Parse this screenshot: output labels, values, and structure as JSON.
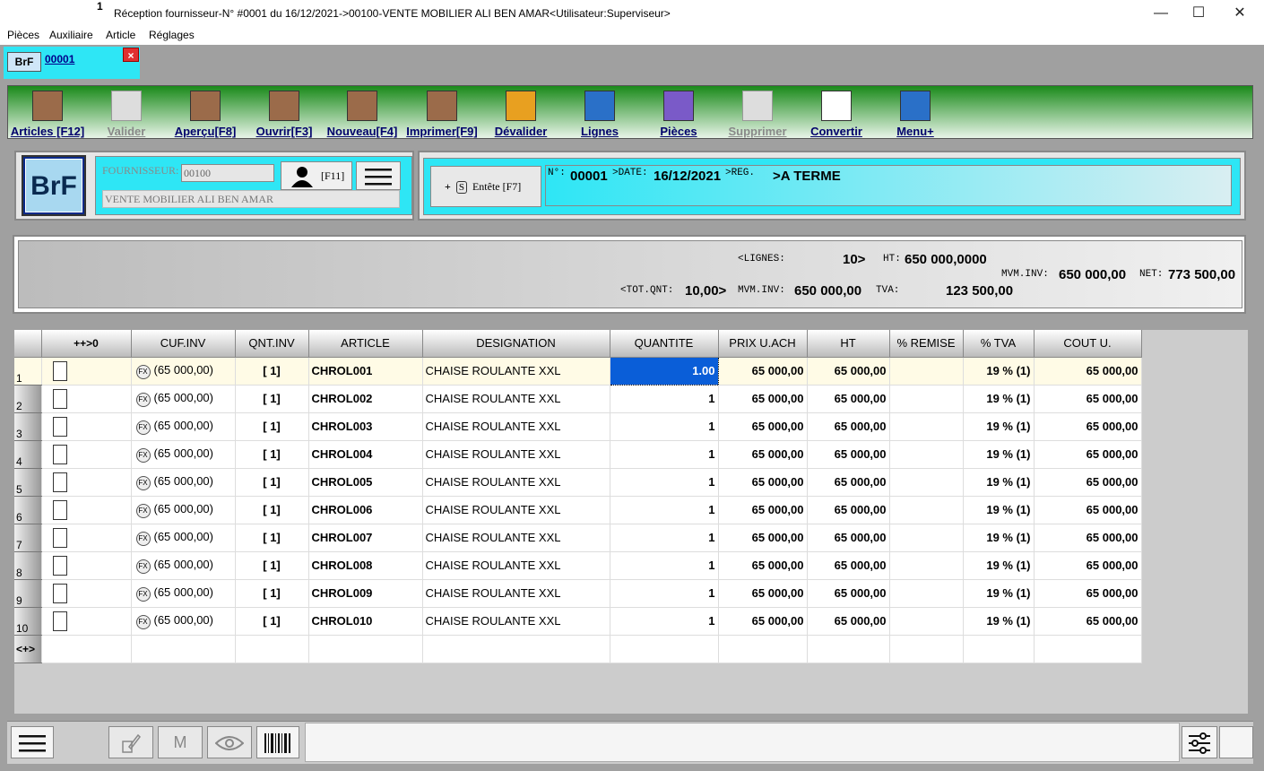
{
  "window": {
    "number": "1",
    "title": "Réception fournisseur-N° #0001 du 16/12/2021->00100-VENTE MOBILIER ALI BEN AMAR<Utilisateur:Superviseur>",
    "minimize": "—",
    "maximize": "☐",
    "close": "✕"
  },
  "menubar": [
    "Pièces",
    "Auxiliaire",
    "Article",
    "Réglages"
  ],
  "tab": {
    "code": "BrF",
    "number": "00001",
    "close": "×"
  },
  "toolbar": [
    {
      "label": "Articles [F12]",
      "icon": "articles-icon",
      "enabled": true,
      "color": "#9b6b4a"
    },
    {
      "label": "Valider",
      "icon": "validate-icon",
      "enabled": false,
      "color": "#dddddd"
    },
    {
      "label": "Aperçu[F8]",
      "icon": "preview-icon",
      "enabled": true,
      "color": "#9b6b4a"
    },
    {
      "label": "Ouvrir[F3]",
      "icon": "open-icon",
      "enabled": true,
      "color": "#9b6b4a"
    },
    {
      "label": "Nouveau[F4]",
      "icon": "new-icon",
      "enabled": true,
      "color": "#9b6b4a"
    },
    {
      "label": "Imprimer[F9]",
      "icon": "print-icon",
      "enabled": true,
      "color": "#9b6b4a"
    },
    {
      "label": "Dévalider",
      "icon": "unvalidate-icon",
      "enabled": true,
      "color": "#e8a020"
    },
    {
      "label": "Lignes",
      "icon": "lines-search-icon",
      "enabled": true,
      "color": "#2a70c8"
    },
    {
      "label": "Pièces",
      "icon": "pieces-grid-icon",
      "enabled": true,
      "color": "#7a5ac8"
    },
    {
      "label": "Supprimer",
      "icon": "delete-icon",
      "enabled": false,
      "color": "#dddddd"
    },
    {
      "label": "Convertir",
      "icon": "convert-icon",
      "enabled": true,
      "color": "#ffffff"
    },
    {
      "label": "Menu+",
      "icon": "menu-plus-icon",
      "enabled": true,
      "color": "#2a70c8"
    }
  ],
  "header": {
    "doc_type": "BrF",
    "fournisseur_label": "FOURNISSEUR:",
    "fournisseur_code": "00100",
    "fournisseur_name": "VENTE MOBILIER ALI BEN AMAR",
    "person_shortcut": "[F11]",
    "entete_label": "Entête [F7]",
    "entete_plus": "+",
    "entete_s": "S",
    "num_label": "N°:",
    "num_value": "00001",
    "date_label": ">DATE:",
    "date_value": "16/12/2021",
    "reg_label": ">REG.",
    "reg_value": ">A TERME"
  },
  "totals": {
    "lignes_label": "<LIGNES:",
    "lignes_value": "10>",
    "ht_label": "HT:",
    "ht_value": "650 000,0000",
    "totqnt_label": "<TOT.QNT:",
    "totqnt_value": "10,00>",
    "mvm_inv_label": "MVM.INV:",
    "mvm_inv_value": "650 000,00",
    "tva_label": "TVA:",
    "tva_value": "123 500,00",
    "mvm_inv2_label": "MVM.INV:",
    "mvm_inv2_value": "650 000,00",
    "net_label": "NET:",
    "net_value": "773 500,00"
  },
  "grid": {
    "columns": [
      "++>0",
      "CUF.INV",
      "QNT.INV",
      "ARTICLE",
      "DESIGNATION",
      "QUANTITE",
      "PRIX U.ACH",
      "HT",
      "% REMISE",
      "% TVA",
      "COUT U."
    ],
    "rows": [
      {
        "n": "1",
        "cuf": "(65 000,00)",
        "qnt_inv": "[ 1]",
        "article": "CHROL001",
        "designation": "CHAISE ROULANTE XXL",
        "quantite": "1.00",
        "prix": "65 000,00",
        "ht": "65 000,00",
        "remise": "",
        "tva": "19 % (1)",
        "cout": "65 000,00"
      },
      {
        "n": "2",
        "cuf": "(65 000,00)",
        "qnt_inv": "[ 1]",
        "article": "CHROL002",
        "designation": "CHAISE ROULANTE XXL",
        "quantite": "1",
        "prix": "65 000,00",
        "ht": "65 000,00",
        "remise": "",
        "tva": "19 % (1)",
        "cout": "65 000,00"
      },
      {
        "n": "3",
        "cuf": "(65 000,00)",
        "qnt_inv": "[ 1]",
        "article": "CHROL003",
        "designation": "CHAISE ROULANTE XXL",
        "quantite": "1",
        "prix": "65 000,00",
        "ht": "65 000,00",
        "remise": "",
        "tva": "19 % (1)",
        "cout": "65 000,00"
      },
      {
        "n": "4",
        "cuf": "(65 000,00)",
        "qnt_inv": "[ 1]",
        "article": "CHROL004",
        "designation": "CHAISE ROULANTE XXL",
        "quantite": "1",
        "prix": "65 000,00",
        "ht": "65 000,00",
        "remise": "",
        "tva": "19 % (1)",
        "cout": "65 000,00"
      },
      {
        "n": "5",
        "cuf": "(65 000,00)",
        "qnt_inv": "[ 1]",
        "article": "CHROL005",
        "designation": "CHAISE ROULANTE XXL",
        "quantite": "1",
        "prix": "65 000,00",
        "ht": "65 000,00",
        "remise": "",
        "tva": "19 % (1)",
        "cout": "65 000,00"
      },
      {
        "n": "6",
        "cuf": "(65 000,00)",
        "qnt_inv": "[ 1]",
        "article": "CHROL006",
        "designation": "CHAISE ROULANTE XXL",
        "quantite": "1",
        "prix": "65 000,00",
        "ht": "65 000,00",
        "remise": "",
        "tva": "19 % (1)",
        "cout": "65 000,00"
      },
      {
        "n": "7",
        "cuf": "(65 000,00)",
        "qnt_inv": "[ 1]",
        "article": "CHROL007",
        "designation": "CHAISE ROULANTE XXL",
        "quantite": "1",
        "prix": "65 000,00",
        "ht": "65 000,00",
        "remise": "",
        "tva": "19 % (1)",
        "cout": "65 000,00"
      },
      {
        "n": "8",
        "cuf": "(65 000,00)",
        "qnt_inv": "[ 1]",
        "article": "CHROL008",
        "designation": "CHAISE ROULANTE XXL",
        "quantite": "1",
        "prix": "65 000,00",
        "ht": "65 000,00",
        "remise": "",
        "tva": "19 % (1)",
        "cout": "65 000,00"
      },
      {
        "n": "9",
        "cuf": "(65 000,00)",
        "qnt_inv": "[ 1]",
        "article": "CHROL009",
        "designation": "CHAISE ROULANTE XXL",
        "quantite": "1",
        "prix": "65 000,00",
        "ht": "65 000,00",
        "remise": "",
        "tva": "19 % (1)",
        "cout": "65 000,00"
      },
      {
        "n": "10",
        "cuf": "(65 000,00)",
        "qnt_inv": "[ 1]",
        "article": "CHROL010",
        "designation": "CHAISE ROULANTE XXL",
        "quantite": "1",
        "prix": "65 000,00",
        "ht": "65 000,00",
        "remise": "",
        "tva": "19 % (1)",
        "cout": "65 000,00"
      }
    ],
    "new_row_marker": "<+>",
    "fx_label": "FX"
  },
  "bottombar": {
    "menu_icon": "hamburger-icon",
    "edit_icon": "edit-icon",
    "m_label": "M",
    "eye_icon": "eye-icon",
    "barcode_icon": "barcode-icon",
    "settings_icon": "sliders-icon"
  },
  "colors": {
    "cyan": "#2ee6f5",
    "green": "#1a8a1a",
    "selection": "#0a5ed8"
  }
}
